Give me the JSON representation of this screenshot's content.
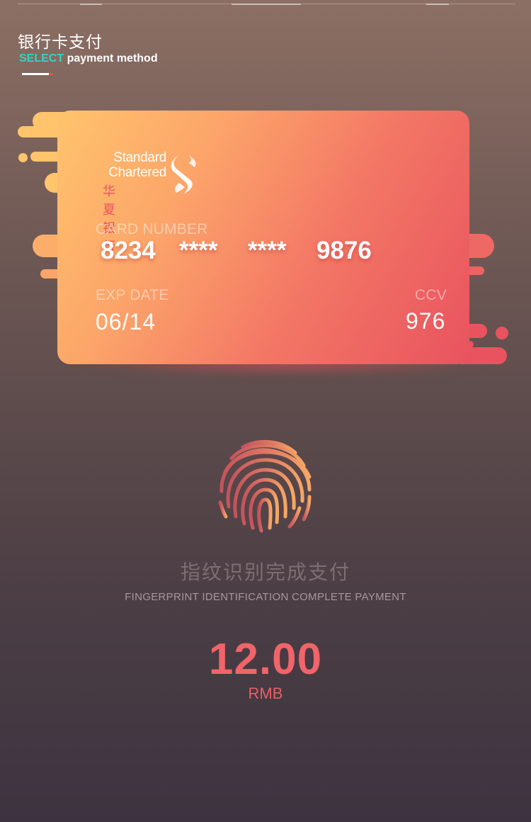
{
  "header": {
    "title": "银行卡支付",
    "subtitle_highlight": "SELECT",
    "subtitle_rest": "payment method"
  },
  "card": {
    "bank_name_en_line1": "Standard",
    "bank_name_en_line2": "Chartered",
    "bank_name_zh": "华夏银行",
    "card_number_label": "CARD NUMBER",
    "card_number_groups": [
      "8234",
      "****",
      "****",
      "9876"
    ],
    "exp_label": "EXP DATE",
    "exp_value": "06/14",
    "ccv_label": "CCV",
    "ccv_value": "976"
  },
  "fingerprint": {
    "title_zh": "指纹识别完成支付",
    "title_en": "FINGERPRINT IDENTIFICATION COMPLETE PAYMENT",
    "icon": "fingerprint-icon"
  },
  "payment": {
    "amount": "12.00",
    "currency": "RMB"
  },
  "colors": {
    "accent_teal": "#33d4c8",
    "card_gradient_start": "#ffc46c",
    "card_gradient_end": "#e8535f",
    "amount_red": "#f0646a"
  }
}
